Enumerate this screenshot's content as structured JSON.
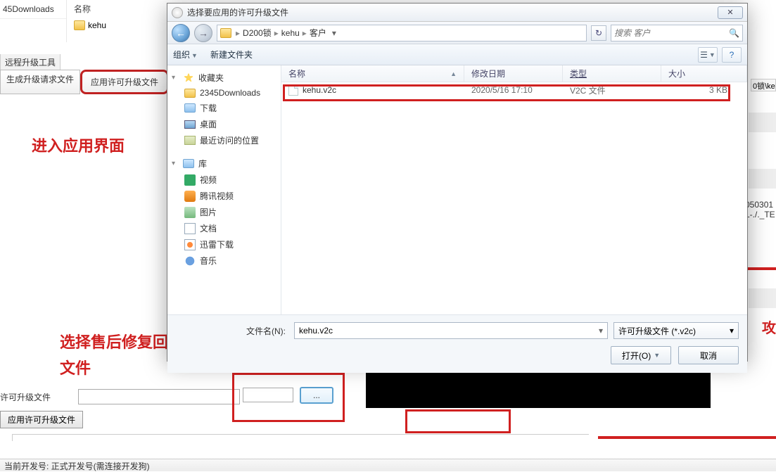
{
  "bg": {
    "left_item": "45Downloads",
    "name_header": "名称",
    "name_row": "kehu"
  },
  "tool_label": "远程升级工具",
  "tabs": {
    "generate": "生成升级请求文件",
    "apply": "应用许可升级文件"
  },
  "annotations": {
    "enter_ui": "进入应用界面",
    "select_file": "选择售后修复回传的\n文件"
  },
  "bottom": {
    "label": "许可升级文件",
    "apply_btn": "应用许可升级文件",
    "browse_btn": "...",
    "status": "当前开发号: 正式开发号(需连接开发狗)"
  },
  "dialog": {
    "title": "选择要应用的许可升级文件",
    "breadcrumb": [
      "D200锁",
      "kehu",
      "客户"
    ],
    "search_placeholder": "搜索 客户",
    "toolbar": {
      "organize": "组织",
      "new_folder": "新建文件夹"
    },
    "sidebar": {
      "favorites": "收藏夹",
      "fav_items": [
        "2345Downloads",
        "下载",
        "桌面",
        "最近访问的位置"
      ],
      "libraries": "库",
      "lib_items": [
        "视频",
        "腾讯视频",
        "图片",
        "文档",
        "迅雷下载",
        "音乐"
      ]
    },
    "columns": {
      "name": "名称",
      "date": "修改日期",
      "type": "类型",
      "size": "大小"
    },
    "rows": [
      {
        "name": "kehu.v2c",
        "date": "2020/5/16 17:10",
        "type": "V2C 文件",
        "size": "3 KB"
      }
    ],
    "filename_label": "文件名(N):",
    "filename_value": "kehu.v2c",
    "filter": "许可升级文件 (*.v2c)",
    "open": "打开(O)",
    "cancel": "取消"
  },
  "right_fragments": {
    "frag1": "0锁\\ke",
    "frag2a": "050301",
    "frag2b": "L-./._TE",
    "red_char": "攻"
  }
}
